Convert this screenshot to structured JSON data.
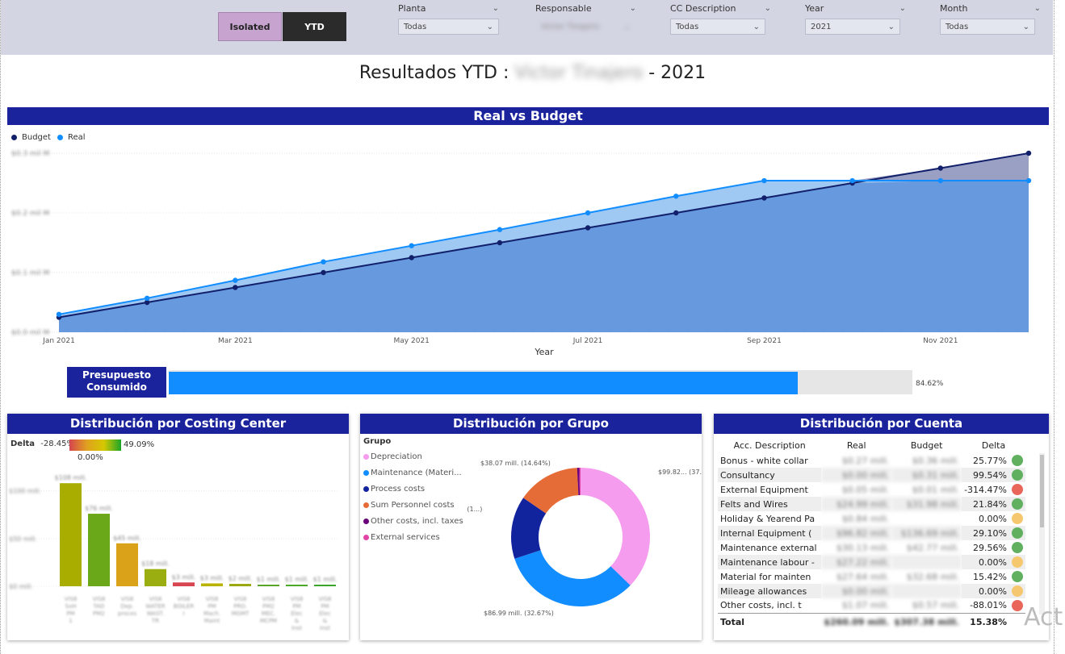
{
  "toggles": {
    "isolated": "Isolated",
    "ytd": "YTD"
  },
  "slicers": [
    {
      "label": "Planta",
      "value": "Todas"
    },
    {
      "label": "Responsable",
      "value": "Victor Tinajero"
    },
    {
      "label": "CC Description",
      "value": "Todas"
    },
    {
      "label": "Year",
      "value": "2021"
    },
    {
      "label": "Month",
      "value": "Todas"
    }
  ],
  "title": {
    "prefix": "Resultados YTD :",
    "name": "Victor Tinajero",
    "suffix": "-  2021"
  },
  "banners": {
    "real_vs_budget": "Real vs Budget",
    "costing_center": "Distribución por Costing Center",
    "grupo": "Distribución por Grupo",
    "cuenta": "Distribución por Cuenta"
  },
  "gauge": {
    "label_line1": "Presupuesto",
    "label_line2": "Consumido",
    "percent_value": 84.62,
    "value_text": "84.62%"
  },
  "colors": {
    "banner": "#1a239c",
    "budget": "#12206b",
    "real": "#118dff",
    "area": "#6699dd",
    "area_over": "#9aa0c4"
  },
  "chart_data": [
    {
      "type": "area",
      "title": "Real vs Budget",
      "xlabel": "Year",
      "ylabel": "",
      "x": [
        "Jan 2021",
        "Feb 2021",
        "Mar 2021",
        "Apr 2021",
        "May 2021",
        "Jun 2021",
        "Jul 2021",
        "Aug 2021",
        "Sep 2021",
        "Oct 2021",
        "Nov 2021",
        "Dec 2021"
      ],
      "x_tick_labels": [
        "Jan 2021",
        "Mar 2021",
        "May 2021",
        "Jul 2021",
        "Sep 2021",
        "Nov 2021"
      ],
      "y_tick_labels": [
        "$0.0 mil M",
        "$0.1 mil M",
        "$0.2 mil M",
        "$0.3 mil M"
      ],
      "ylim": [
        0,
        0.3
      ],
      "legend": "top-left",
      "series": [
        {
          "name": "Budget",
          "values": [
            0.025,
            0.05,
            0.075,
            0.1,
            0.125,
            0.15,
            0.175,
            0.2,
            0.225,
            0.25,
            0.275,
            0.3
          ]
        },
        {
          "name": "Real",
          "values": [
            0.03,
            0.057,
            0.087,
            0.118,
            0.145,
            0.172,
            0.2,
            0.228,
            0.254,
            0.254,
            0.254,
            0.254
          ]
        }
      ]
    },
    {
      "type": "bar",
      "title": "Distribución por Costing Center",
      "legend_title": "Delta",
      "delta_min": "-28.45%",
      "delta_max": "49.09%",
      "delta_mid": "0.00%",
      "y_tick_labels": [
        "$0 mill.",
        "$50 mill.",
        "$100 mill."
      ],
      "ylim": [
        0,
        120
      ],
      "categories": [
        "VIS8 SoH PM 1",
        "VIS8 TAD PM2",
        "VIS8 Dep. proces",
        "VIS8 WATER WAST. TR",
        "VIS8 BOILER I",
        "VIS8 PM Mach. Maint",
        "VIS8 PRO. MGMT",
        "VIS8 PM2 MEC. MCPM",
        "VIS8 PM Elec & Inst",
        "VIS8 PM Elec & Inst"
      ],
      "values": [
        108,
        76,
        45,
        18,
        4,
        3,
        2.5,
        1,
        1,
        1
      ],
      "value_labels": [
        "$108 mill.",
        "$76 mill.",
        "$45 mill.",
        "$18 mill.",
        "$3 mill.",
        "$3 mill.",
        "$2 mill.",
        "$1 mill.",
        "$1 mill.",
        "$1 mill."
      ],
      "bar_colors": [
        "#a8ad00",
        "#6aa81a",
        "#d9a218",
        "#9aae12",
        "#d64550",
        "#b9b300",
        "#9aa810",
        "#5ba32a",
        "#4aa82a",
        "#3aa52a"
      ]
    },
    {
      "type": "pie",
      "title": "Distribución por Grupo",
      "legend_title": "Grupo",
      "categories": [
        "Depreciation",
        "Maintenance (Materi...",
        "Process costs",
        "Sum Personnel costs",
        "Other costs, incl. taxes",
        "External services"
      ],
      "values": [
        37.26,
        32.67,
        14.64,
        14.64,
        0.5,
        0.29
      ],
      "slice_labels": [
        "$99.82... (37.26%)",
        "$86.99 mill. (32.67%)",
        "$3... (1...)",
        "$38.07 mill. (14.64%)",
        "",
        ""
      ],
      "slice_colors": [
        "#f59cee",
        "#118dff",
        "#12239e",
        "#e66c37",
        "#6b007b",
        "#e044a7"
      ]
    }
  ],
  "cuenta_table": {
    "headers": [
      "Acc. Description",
      "Real",
      "Budget",
      "Delta"
    ],
    "rows": [
      {
        "desc": "Bonus - white collar",
        "real": "$0.27 mill.",
        "budget": "$0.36 mill.",
        "delta": "25.77%",
        "status": "#60b060"
      },
      {
        "desc": "Consultancy",
        "real": "$0.00 mill.",
        "budget": "$0.31 mill.",
        "delta": "99.54%",
        "status": "#60b060"
      },
      {
        "desc": "External Equipment",
        "real": "$0.05 mill.",
        "budget": "$0.01 mill.",
        "delta": "-314.47%",
        "status": "#e8675a"
      },
      {
        "desc": "Felts and Wires",
        "real": "$24.99 mill.",
        "budget": "$31.98 mill.",
        "delta": "21.84%",
        "status": "#60b060"
      },
      {
        "desc": "Holiday & Yearend Pa",
        "real": "$0.84 mill.",
        "budget": "",
        "delta": "0.00%",
        "status": "#f5c870"
      },
      {
        "desc": "Internal Equipment (",
        "real": "$96.82 mill.",
        "budget": "$136.69 mill.",
        "delta": "29.10%",
        "status": "#60b060"
      },
      {
        "desc": "Maintenance external",
        "real": "$30.13 mill.",
        "budget": "$42.77 mill.",
        "delta": "29.56%",
        "status": "#60b060"
      },
      {
        "desc": "Maintenance labour -",
        "real": "$27.22 mill.",
        "budget": "",
        "delta": "0.00%",
        "status": "#f5c870"
      },
      {
        "desc": "Material for mainten",
        "real": "$27.64 mill.",
        "budget": "$32.68 mill.",
        "delta": "15.42%",
        "status": "#60b060"
      },
      {
        "desc": "Mileage allowances",
        "real": "$0.00 mill.",
        "budget": "",
        "delta": "0.00%",
        "status": "#f5c870"
      },
      {
        "desc": "Other costs, incl. t",
        "real": "$1.07 mill.",
        "budget": "$0.57 mill.",
        "delta": "-88.01%",
        "status": "#e8675a"
      }
    ],
    "total": {
      "desc": "Total",
      "real": "$260.09 mill.",
      "budget": "$307.38 mill.",
      "delta": "15.38%"
    }
  },
  "watermark": "Act"
}
